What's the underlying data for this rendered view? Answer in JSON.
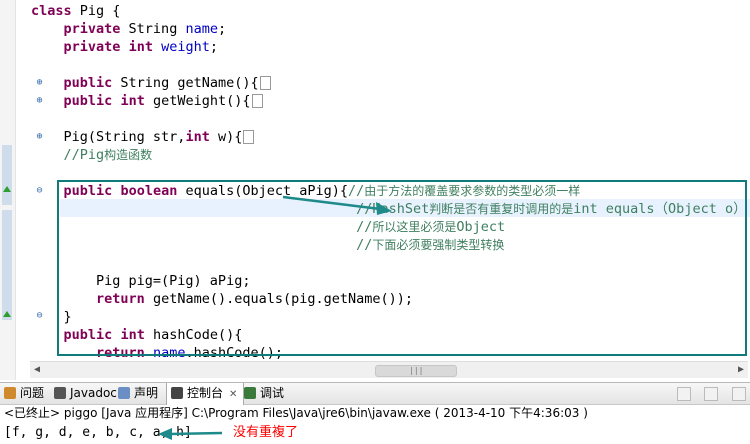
{
  "code_lines": [
    {
      "segments": [
        {
          "c": "kw",
          "t": "class"
        },
        {
          "c": "",
          "t": " Pig {"
        }
      ]
    },
    {
      "segments": [
        {
          "c": "",
          "t": "    "
        },
        {
          "c": "kw",
          "t": "private"
        },
        {
          "c": "",
          "t": " String "
        },
        {
          "c": "fld",
          "t": "name"
        },
        {
          "c": "",
          "t": ";"
        }
      ]
    },
    {
      "segments": [
        {
          "c": "",
          "t": "    "
        },
        {
          "c": "kw",
          "t": "private"
        },
        {
          "c": "",
          "t": " "
        },
        {
          "c": "kw",
          "t": "int"
        },
        {
          "c": "",
          "t": " "
        },
        {
          "c": "fld",
          "t": "weight"
        },
        {
          "c": "",
          "t": ";"
        }
      ]
    },
    {
      "segments": []
    },
    {
      "segments": [
        {
          "c": "",
          "t": "    "
        },
        {
          "c": "kw",
          "t": "public"
        },
        {
          "c": "",
          "t": " String getName(){"
        }
      ],
      "collapsed": true
    },
    {
      "segments": [
        {
          "c": "",
          "t": "    "
        },
        {
          "c": "kw",
          "t": "public"
        },
        {
          "c": "",
          "t": " "
        },
        {
          "c": "kw",
          "t": "int"
        },
        {
          "c": "",
          "t": " getWeight(){"
        }
      ],
      "collapsed": true
    },
    {
      "segments": []
    },
    {
      "segments": [
        {
          "c": "",
          "t": "    Pig(String str,"
        },
        {
          "c": "kw",
          "t": "int"
        },
        {
          "c": "",
          "t": " w){"
        }
      ],
      "collapsed": true
    },
    {
      "segments": [
        {
          "c": "",
          "t": "    "
        },
        {
          "c": "cm",
          "t": "//Pig"
        },
        {
          "c": "cmz",
          "t": "构造函数"
        }
      ]
    },
    {
      "segments": []
    },
    {
      "segments": [
        {
          "c": "",
          "t": "    "
        },
        {
          "c": "kw",
          "t": "public"
        },
        {
          "c": "",
          "t": " "
        },
        {
          "c": "kw",
          "t": "boolean"
        },
        {
          "c": "",
          "t": " equals(Object aPig){"
        },
        {
          "c": "cm",
          "t": "//"
        },
        {
          "c": "cmz",
          "t": "由于方法的覆盖要求参数的类型必须一样"
        }
      ]
    },
    {
      "segments": [
        {
          "c": "",
          "t": "                                        "
        },
        {
          "c": "cm",
          "t": "//HashSet"
        },
        {
          "c": "cmz",
          "t": "判断是否有重复时调用的是"
        },
        {
          "c": "cm",
          "t": "int equals（Object o）"
        }
      ]
    },
    {
      "segments": [
        {
          "c": "",
          "t": "                                        "
        },
        {
          "c": "cm",
          "t": "//"
        },
        {
          "c": "cmz",
          "t": "所以这里必须是"
        },
        {
          "c": "cm",
          "t": "Object"
        }
      ]
    },
    {
      "segments": [
        {
          "c": "",
          "t": "                                        "
        },
        {
          "c": "cm",
          "t": "//"
        },
        {
          "c": "cmz",
          "t": "下面必须要强制类型转换"
        }
      ]
    },
    {
      "segments": []
    },
    {
      "segments": [
        {
          "c": "",
          "t": "        Pig pig=(Pig) aPig;"
        }
      ]
    },
    {
      "segments": [
        {
          "c": "",
          "t": "        "
        },
        {
          "c": "kw",
          "t": "return"
        },
        {
          "c": "",
          "t": " getName().equals(pig.getName());"
        }
      ]
    },
    {
      "segments": [
        {
          "c": "",
          "t": "    }"
        }
      ]
    },
    {
      "segments": [
        {
          "c": "",
          "t": "    "
        },
        {
          "c": "kw",
          "t": "public"
        },
        {
          "c": "",
          "t": " "
        },
        {
          "c": "kw",
          "t": "int"
        },
        {
          "c": "",
          "t": " hashCode(){"
        }
      ]
    },
    {
      "segments": [
        {
          "c": "",
          "t": "        "
        },
        {
          "c": "kw",
          "t": "return"
        },
        {
          "c": "",
          "t": " "
        },
        {
          "c": "fld",
          "t": "name"
        },
        {
          "c": "",
          "t": ".hashCode();"
        }
      ]
    },
    {
      "segments": [
        {
          "c": "",
          "t": "    }"
        }
      ]
    }
  ],
  "tabs": [
    {
      "label": "问题",
      "icon": "problems-icon",
      "color": "#d08a2e"
    },
    {
      "label": "Javadoc",
      "icon": "at-icon",
      "color": "#555555"
    },
    {
      "label": "声明",
      "icon": "declaration-icon",
      "color": "#6b8fc4"
    },
    {
      "label": "控制台",
      "icon": "console-icon",
      "color": "#444444",
      "active": true
    },
    {
      "label": "调试",
      "icon": "debug-icon",
      "color": "#3a7a3a"
    }
  ],
  "status": "<已终止> piggo [Java 应用程序] C:\\Program Files\\Java\\jre6\\bin\\javaw.exe ( 2013-4-10 下午4:36:03 )",
  "output": "[f, g, d, e, b, c, a, h]",
  "annotation": "没有重複了",
  "colors": {
    "annotation_arrow": "#1e8a8a",
    "box": "#0f7b7b",
    "annotation_text": "#ff0000"
  }
}
